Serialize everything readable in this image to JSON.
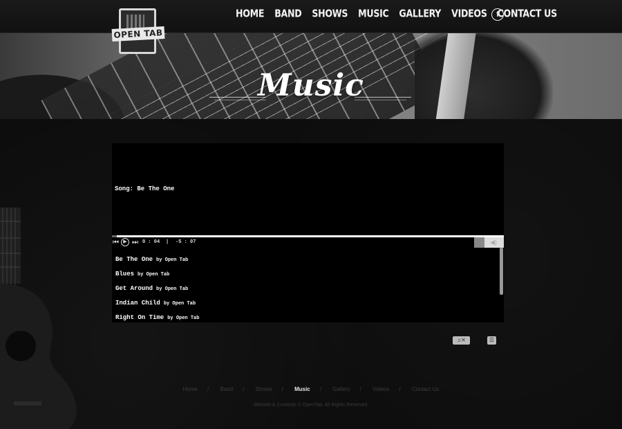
{
  "site": {
    "logo_text": "OPEN TAB"
  },
  "nav": {
    "items": [
      {
        "label": "HOME"
      },
      {
        "label": "BAND"
      },
      {
        "label": "SHOWS"
      },
      {
        "label": "MUSIC"
      },
      {
        "label": "GALLERY"
      },
      {
        "label": "VIDEOS"
      },
      {
        "label": "CONTACT US"
      }
    ],
    "facebook_glyph": "f"
  },
  "banner": {
    "title": "Music"
  },
  "player": {
    "song_label": "Song: Be The One",
    "elapsed": "0 : 04",
    "separator": "|",
    "remaining": "-5 : 07",
    "progress_fraction": 0.012,
    "volume_fraction": 0.35,
    "playlist": [
      {
        "title": "Be The One",
        "artist": "by Open Tab"
      },
      {
        "title": "Blues",
        "artist": "by Open Tab"
      },
      {
        "title": "Get Around",
        "artist": "by Open Tab"
      },
      {
        "title": "Indian Child",
        "artist": "by Open Tab"
      },
      {
        "title": "Right On Time",
        "artist": "by Open Tab"
      }
    ]
  },
  "footer": {
    "links": [
      {
        "label": "Home",
        "active": false
      },
      {
        "label": "Band",
        "active": false
      },
      {
        "label": "Shows",
        "active": false
      },
      {
        "label": "Music",
        "active": true
      },
      {
        "label": "Gallery",
        "active": false
      },
      {
        "label": "Videos",
        "active": false
      },
      {
        "label": "Contact Us",
        "active": false
      }
    ],
    "separator": "/",
    "copyright": "Website & Contents © OpenTab. All Rights Reserved."
  },
  "colors": {
    "background": "#0c0c0c",
    "nav_text": "#f4f4f4",
    "footer_active": "#e8e8e8",
    "footer_inactive": "#3d3d3d"
  }
}
